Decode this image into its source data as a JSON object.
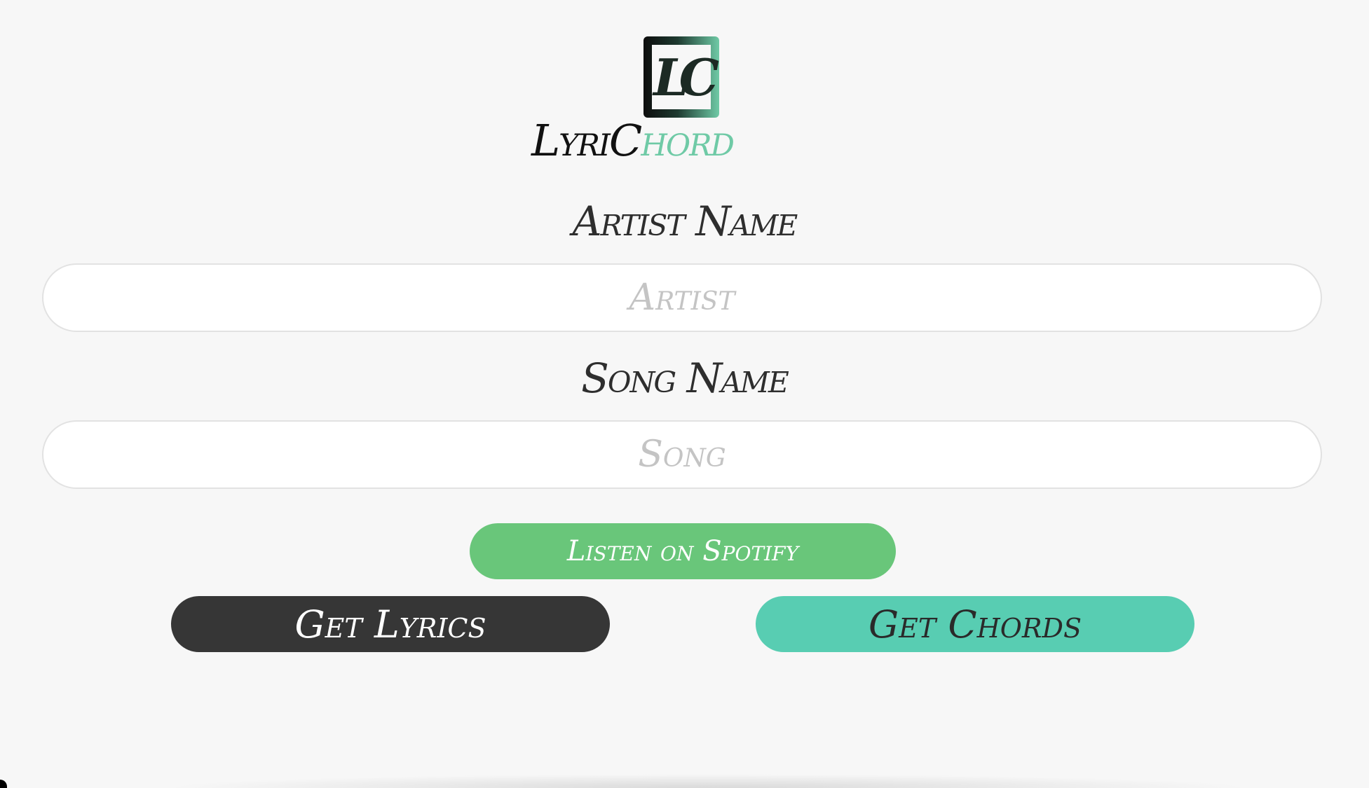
{
  "app": {
    "logo_mark": "LC",
    "logo_word_part1": "LyriC",
    "logo_word_part2": "hord"
  },
  "form": {
    "artist_label": "Artist Name",
    "artist_placeholder": "Artist",
    "artist_value": "",
    "song_label": "Song Name",
    "song_placeholder": "Song",
    "song_value": ""
  },
  "actions": {
    "spotify_label": "Listen on Spotify",
    "lyrics_label": "Get Lyrics",
    "chords_label": "Get Chords"
  },
  "colors": {
    "background": "#f7f7f7",
    "spotify_green": "#69c67a",
    "lyrics_dark": "#363636",
    "chords_teal": "#58cdb2",
    "logo_accent": "#6fcaa6"
  }
}
